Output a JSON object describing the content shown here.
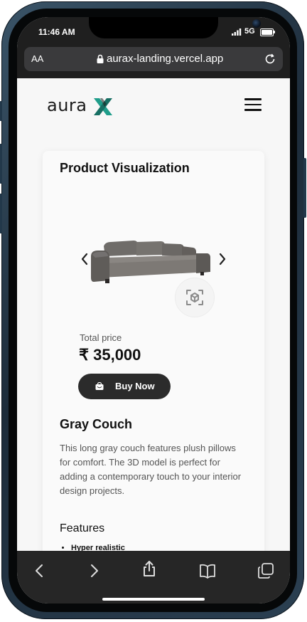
{
  "status_bar": {
    "time": "11:46 AM",
    "network": "5G",
    "icons": [
      "signal-icon",
      "battery-icon"
    ]
  },
  "browser": {
    "text_size_button": "AA",
    "url": "aurax-landing.vercel.app",
    "icons": [
      "lock-icon",
      "reload-icon"
    ]
  },
  "header": {
    "logo_text": "aura",
    "logo_mark": "X",
    "brand_color": "#1f9d8a",
    "menu_icon": "hamburger-icon"
  },
  "product_card": {
    "section_title": "Product Visualization",
    "model_image": "gray-couch",
    "ar_icon": "3d-cube-icon",
    "price_label": "Total price",
    "price": "₹ 35,000",
    "buy_button_label": "Buy Now",
    "product_name": "Gray Couch",
    "description": "This long gray couch features plush pillows for comfort. The 3D model is perfect for adding a contemporary touch to your interior design projects.",
    "features_title": "Features",
    "features": [
      "Hyper realistic"
    ]
  },
  "toolbar": {
    "icons": [
      "back-icon",
      "forward-icon",
      "share-icon",
      "bookmarks-icon",
      "tabs-icon"
    ]
  }
}
